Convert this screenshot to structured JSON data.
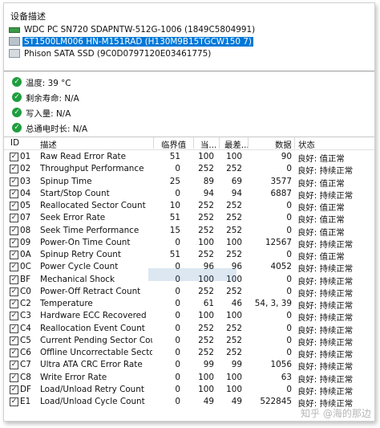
{
  "devices": {
    "title": "设备描述",
    "items": [
      {
        "label": "WDC PC SN720 SDAPNTW-512G-1006 (1849C5804991)",
        "icon": "nvme-drive-icon",
        "selected": false
      },
      {
        "label": "ST1500LM006 HN-M151RAD (H130M9B15TGCW150 7)",
        "icon": "hdd-drive-icon",
        "selected": true
      },
      {
        "label": "Phison SATA SSD (9C0D0797120E03461775)",
        "icon": "ssd-drive-icon",
        "selected": false
      }
    ]
  },
  "status": [
    {
      "label": "温度: 39 °C"
    },
    {
      "label": "剩余寿命: N/A"
    },
    {
      "label": "写入量: N/A"
    },
    {
      "label": "总通电时长: N/A"
    }
  ],
  "table": {
    "headers": {
      "id": "ID",
      "name": "描述",
      "threshold": "临界值",
      "current": "当...",
      "worst": "最差...",
      "raw": "数据",
      "status": "状态"
    },
    "rows": [
      {
        "id": "01",
        "name": "Raw Read Error Rate",
        "threshold": "51",
        "current": "100",
        "worst": "100",
        "raw": "90",
        "status": "良好: 值正常"
      },
      {
        "id": "02",
        "name": "Throughput Performance",
        "threshold": "0",
        "current": "252",
        "worst": "252",
        "raw": "0",
        "status": "良好: 持续正常"
      },
      {
        "id": "03",
        "name": "Spinup Time",
        "threshold": "25",
        "current": "89",
        "worst": "69",
        "raw": "3577",
        "status": "良好: 值正常"
      },
      {
        "id": "04",
        "name": "Start/Stop Count",
        "threshold": "0",
        "current": "94",
        "worst": "94",
        "raw": "6887",
        "status": "良好: 持续正常"
      },
      {
        "id": "05",
        "name": "Reallocated Sector Count",
        "threshold": "10",
        "current": "252",
        "worst": "252",
        "raw": "0",
        "status": "良好: 值正常"
      },
      {
        "id": "07",
        "name": "Seek Error Rate",
        "threshold": "51",
        "current": "252",
        "worst": "252",
        "raw": "0",
        "status": "良好: 值正常"
      },
      {
        "id": "08",
        "name": "Seek Time Performance",
        "threshold": "15",
        "current": "252",
        "worst": "252",
        "raw": "0",
        "status": "良好: 值正常"
      },
      {
        "id": "09",
        "name": "Power-On Time Count",
        "threshold": "0",
        "current": "100",
        "worst": "100",
        "raw": "12567",
        "status": "良好: 持续正常"
      },
      {
        "id": "0A",
        "name": "Spinup Retry Count",
        "threshold": "51",
        "current": "252",
        "worst": "252",
        "raw": "0",
        "status": "良好: 值正常"
      },
      {
        "id": "0C",
        "name": "Power Cycle Count",
        "threshold": "0",
        "current": "96",
        "worst": "96",
        "raw": "4052",
        "status": "良好: 持续正常"
      },
      {
        "id": "BF",
        "name": "Mechanical Shock",
        "threshold": "0",
        "current": "100",
        "worst": "100",
        "raw": "0",
        "status": "良好: 持续正常"
      },
      {
        "id": "C0",
        "name": "Power-Off Retract Count",
        "threshold": "0",
        "current": "252",
        "worst": "252",
        "raw": "0",
        "status": "良好: 持续正常"
      },
      {
        "id": "C2",
        "name": "Temperature",
        "threshold": "0",
        "current": "61",
        "worst": "46",
        "raw": "54, 3, 39",
        "status": "良好: 持续正常"
      },
      {
        "id": "C3",
        "name": "Hardware ECC Recovered",
        "threshold": "0",
        "current": "100",
        "worst": "100",
        "raw": "0",
        "status": "良好: 持续正常"
      },
      {
        "id": "C4",
        "name": "Reallocation Event Count",
        "threshold": "0",
        "current": "252",
        "worst": "252",
        "raw": "0",
        "status": "良好: 持续正常"
      },
      {
        "id": "C5",
        "name": "Current Pending Sector Count",
        "threshold": "0",
        "current": "252",
        "worst": "252",
        "raw": "0",
        "status": "良好: 持续正常"
      },
      {
        "id": "C6",
        "name": "Offline Uncorrectable Sector Co...",
        "threshold": "0",
        "current": "252",
        "worst": "252",
        "raw": "0",
        "status": "良好: 持续正常"
      },
      {
        "id": "C7",
        "name": "Ultra ATA CRC Error Rate",
        "threshold": "0",
        "current": "99",
        "worst": "99",
        "raw": "1056",
        "status": "良好: 持续正常"
      },
      {
        "id": "C8",
        "name": "Write Error Rate",
        "threshold": "0",
        "current": "100",
        "worst": "100",
        "raw": "63",
        "status": "良好: 持续正常"
      },
      {
        "id": "DF",
        "name": "Load/Unload Retry Count",
        "threshold": "0",
        "current": "100",
        "worst": "100",
        "raw": "0",
        "status": "良好: 持续正常"
      },
      {
        "id": "E1",
        "name": "Load/Unload Cycle Count",
        "threshold": "0",
        "current": "49",
        "worst": "49",
        "raw": "522845",
        "status": "良好: 持续正常"
      }
    ]
  },
  "watermark": {
    "corner": "知乎 @海的那边"
  },
  "colors": {
    "selection": "#0078d7",
    "ok": "#1e9e3e"
  }
}
